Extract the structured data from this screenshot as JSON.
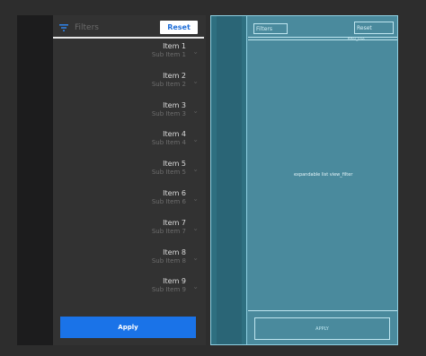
{
  "preview": {
    "filters_placeholder": "Filters",
    "reset_label": "Reset",
    "apply_label": "Apply",
    "items": [
      {
        "title": "Item 1",
        "subtitle": "Sub Item 1"
      },
      {
        "title": "Item 2",
        "subtitle": "Sub Item 2"
      },
      {
        "title": "Item 3",
        "subtitle": "Sub Item 3"
      },
      {
        "title": "Item 4",
        "subtitle": "Sub Item 4"
      },
      {
        "title": "Item 5",
        "subtitle": "Sub Item 5"
      },
      {
        "title": "Item 6",
        "subtitle": "Sub Item 6"
      },
      {
        "title": "Item 7",
        "subtitle": "Sub Item 7"
      },
      {
        "title": "Item 8",
        "subtitle": "Sub Item 8"
      },
      {
        "title": "Item 9",
        "subtitle": "Sub Item 9"
      }
    ],
    "chevron_glyph": "⌄"
  },
  "blueprint": {
    "filters_label": "Filters",
    "reset_label": "Reset",
    "divider_label": "filter_line",
    "list_label": "expandable list view_filter",
    "apply_label": "APPLY"
  },
  "colors": {
    "accent": "#1a73e8",
    "reset_text": "#1f6ed8",
    "preview_bg": "#323232",
    "blueprint_bg": "#4a8a9d",
    "blueprint_line": "#bfe6f0"
  },
  "icons": {
    "filter": "filter-icon"
  }
}
